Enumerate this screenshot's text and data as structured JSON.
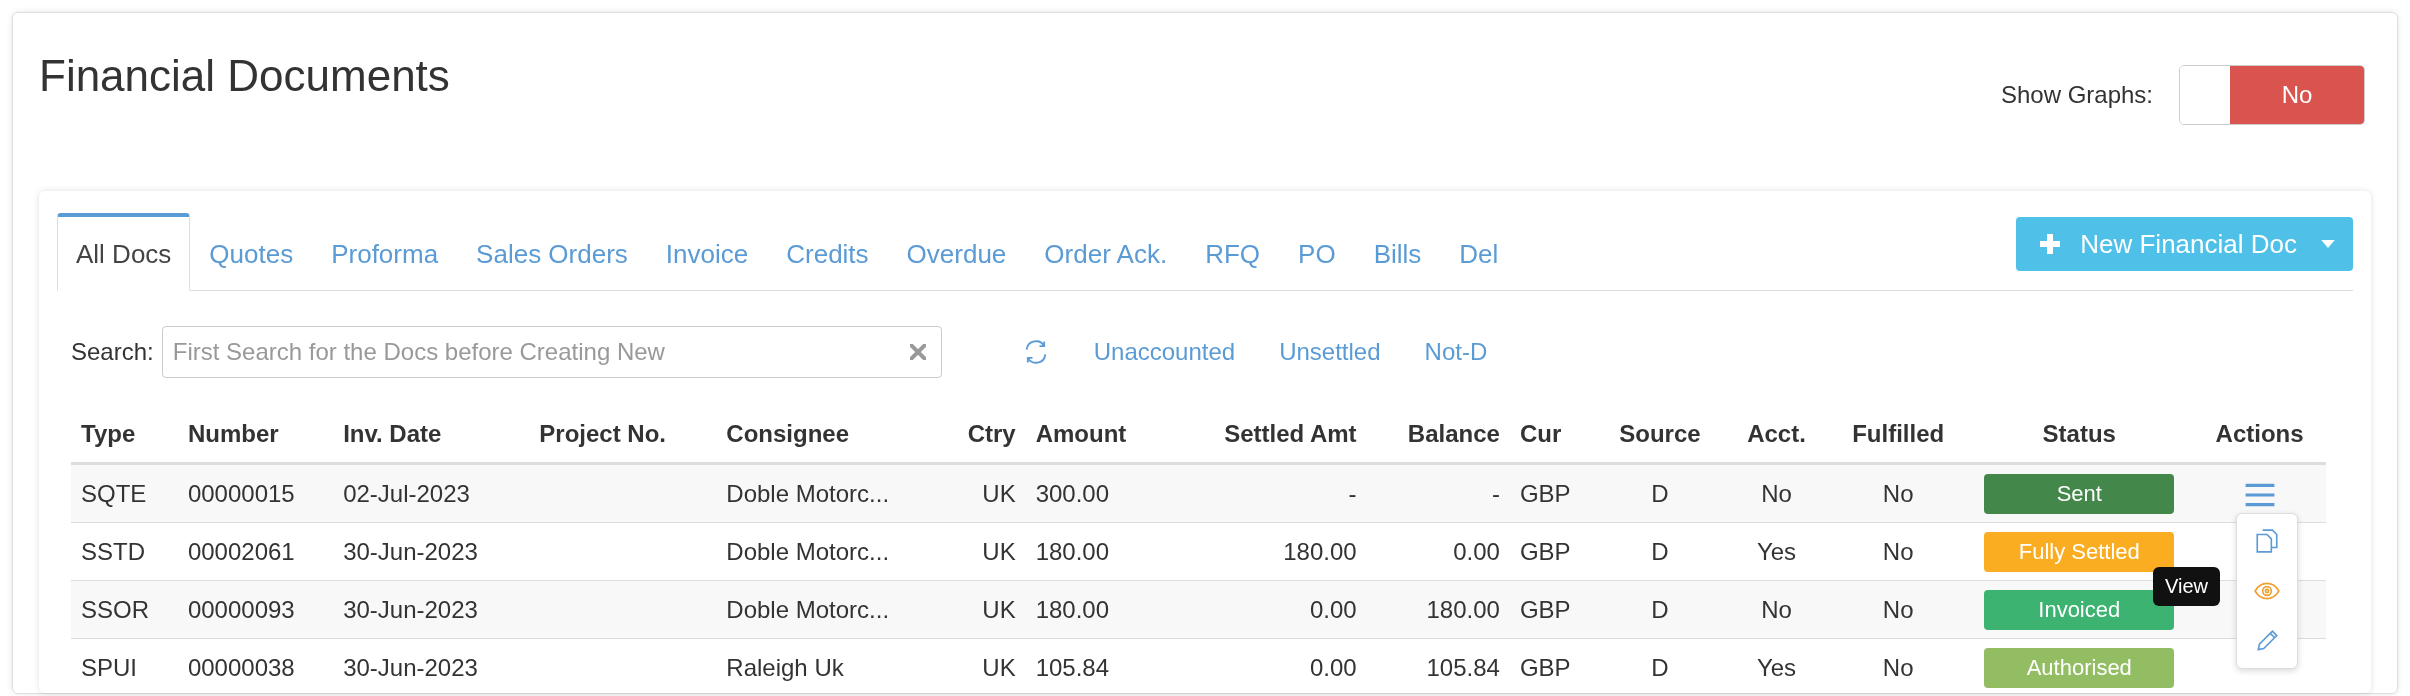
{
  "page_title": "Financial Documents",
  "graphs_toggle": {
    "label": "Show Graphs:",
    "value": "No",
    "on": false
  },
  "tabs": [
    {
      "label": "All Docs",
      "selected": true
    },
    {
      "label": "Quotes",
      "selected": false
    },
    {
      "label": "Proforma",
      "selected": false
    },
    {
      "label": "Sales Orders",
      "selected": false
    },
    {
      "label": "Invoice",
      "selected": false
    },
    {
      "label": "Credits",
      "selected": false
    },
    {
      "label": "Overdue",
      "selected": false
    },
    {
      "label": "Order Ack.",
      "selected": false
    },
    {
      "label": "RFQ",
      "selected": false
    },
    {
      "label": "PO",
      "selected": false
    },
    {
      "label": "Bills",
      "selected": false
    },
    {
      "label": "Del",
      "selected": false
    }
  ],
  "new_button": {
    "label": "New Financial Doc"
  },
  "search": {
    "label": "Search:",
    "placeholder": "First Search for the Docs before Creating New"
  },
  "filter_links": [
    "Unaccounted",
    "Unsettled",
    "Not-D"
  ],
  "table": {
    "columns": [
      "Type",
      "Number",
      "Inv. Date",
      "Project No.",
      "Consignee",
      "Ctry",
      "Amount",
      "Settled Amt",
      "Balance",
      "Cur",
      "Source",
      "Acct.",
      "Fulfilled",
      "Status",
      "Actions"
    ],
    "rows": [
      {
        "cells": [
          "SQTE",
          "00000015",
          "02-Jul-2023",
          "",
          "Doble Motorc...",
          "UK",
          "300.00",
          "-",
          "-",
          "GBP",
          "D",
          "No",
          "No"
        ],
        "status": "Sent",
        "color": "#43874a"
      },
      {
        "cells": [
          "SSTD",
          "00002061",
          "30-Jun-2023",
          "",
          "Doble Motorc...",
          "UK",
          "180.00",
          "180.00",
          "0.00",
          "GBP",
          "D",
          "Yes",
          "No"
        ],
        "status": "Fully Settled",
        "color": "#fbad22"
      },
      {
        "cells": [
          "SSOR",
          "00000093",
          "30-Jun-2023",
          "",
          "Doble Motorc...",
          "UK",
          "180.00",
          "0.00",
          "180.00",
          "GBP",
          "D",
          "No",
          "No"
        ],
        "status": "Invoiced",
        "color": "#3cb371"
      },
      {
        "cells": [
          "SPUI",
          "00000038",
          "30-Jun-2023",
          "",
          "Raleigh Uk",
          "UK",
          "105.84",
          "0.00",
          "105.84",
          "GBP",
          "D",
          "Yes",
          "No"
        ],
        "status": "Authorised",
        "color": "#93bd63"
      }
    ]
  },
  "actions_menu": {
    "tooltip": "View"
  }
}
